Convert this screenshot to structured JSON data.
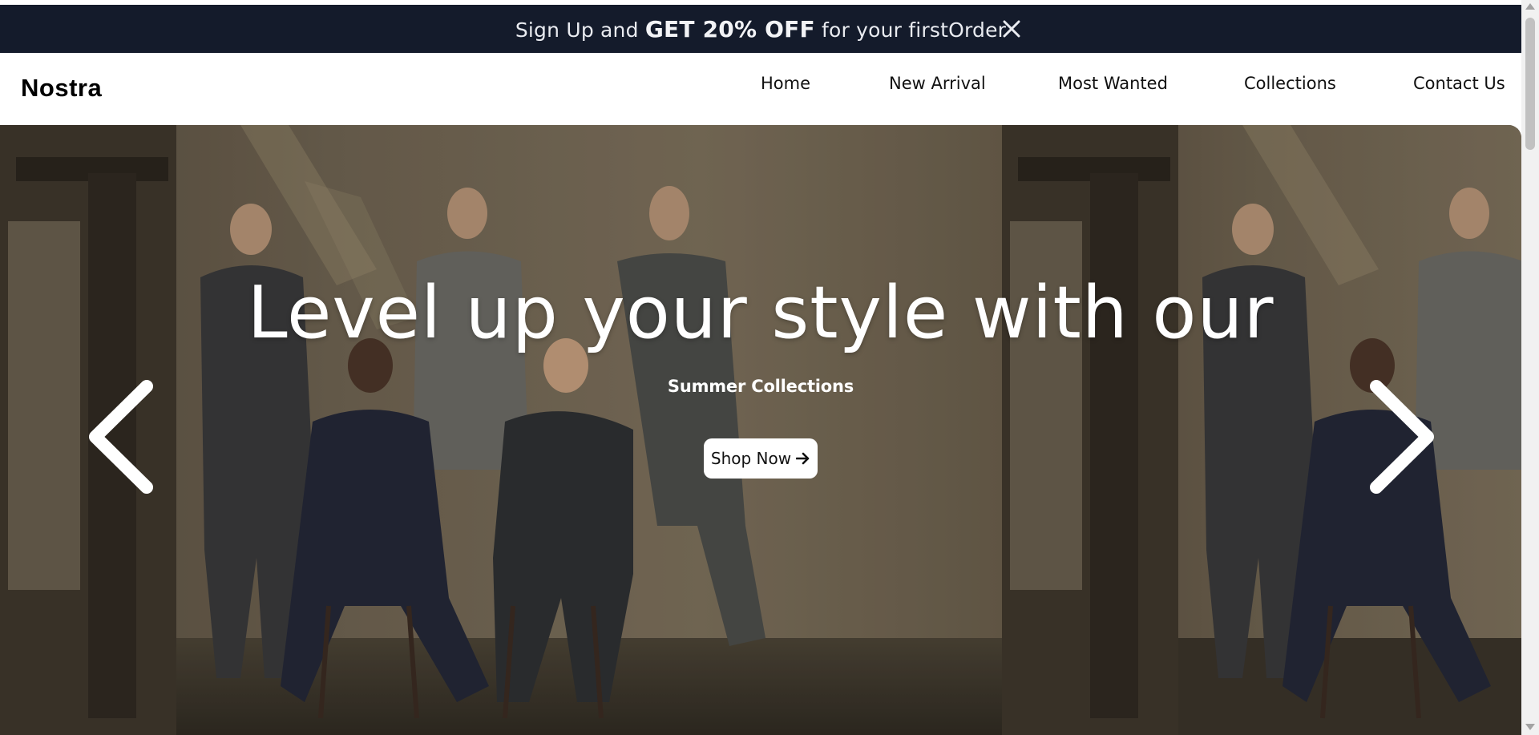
{
  "promo": {
    "prefix": "Sign Up and ",
    "highlight": "GET 20% OFF",
    "suffix": " for your firstOrder",
    "close_icon": "close-icon"
  },
  "nav": {
    "logo": "Nostra",
    "links": [
      "Home",
      "New Arrival",
      "Most Wanted",
      "Collections",
      "Contact Us"
    ]
  },
  "hero": {
    "headline": "Level up your style with our",
    "subheadline": "Summer Collections",
    "cta_label": "Shop Now",
    "cta_icon": "arrow-right-icon",
    "prev_icon": "chevron-left-icon",
    "next_icon": "chevron-right-icon",
    "image_subject": "men-in-suits-photo"
  },
  "colors": {
    "promo_bg": "#141b2b",
    "promo_text": "#e9ebf0",
    "nav_text": "#111111",
    "hero_text": "#ffffff",
    "button_bg": "#ffffff"
  }
}
